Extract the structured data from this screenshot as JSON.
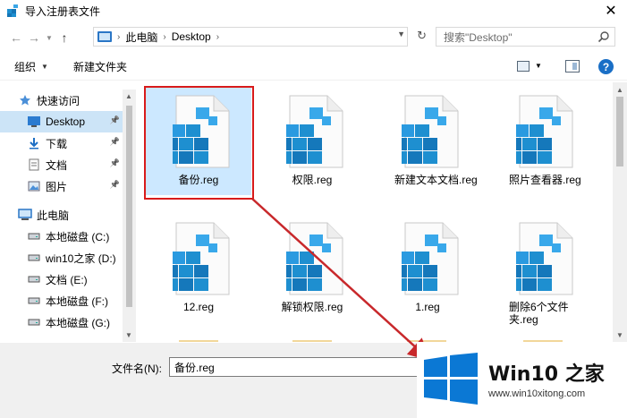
{
  "window": {
    "title": "导入注册表文件"
  },
  "address": {
    "crumbs": [
      "此电脑",
      "Desktop"
    ]
  },
  "search": {
    "placeholder": "搜索\"Desktop\""
  },
  "toolbar": {
    "organize": "组织",
    "new_folder": "新建文件夹"
  },
  "sidebar": {
    "items": [
      {
        "label": "快速访问",
        "icon": "star-icon",
        "pinned": false,
        "selected": false,
        "indent": 1
      },
      {
        "label": "Desktop",
        "icon": "desktop-icon",
        "pinned": true,
        "selected": true,
        "indent": 2
      },
      {
        "label": "下载",
        "icon": "download-icon",
        "pinned": true,
        "selected": false,
        "indent": 2
      },
      {
        "label": "文档",
        "icon": "document-icon",
        "pinned": true,
        "selected": false,
        "indent": 2
      },
      {
        "label": "图片",
        "icon": "picture-icon",
        "pinned": true,
        "selected": false,
        "indent": 2
      },
      {
        "label": "此电脑",
        "icon": "computer-icon",
        "pinned": false,
        "selected": false,
        "indent": 1
      },
      {
        "label": "本地磁盘 (C:)",
        "icon": "drive-icon",
        "pinned": false,
        "selected": false,
        "indent": 2
      },
      {
        "label": "win10之家 (D:)",
        "icon": "drive-icon",
        "pinned": false,
        "selected": false,
        "indent": 2
      },
      {
        "label": "文档 (E:)",
        "icon": "drive-icon",
        "pinned": false,
        "selected": false,
        "indent": 2
      },
      {
        "label": "本地磁盘 (F:)",
        "icon": "drive-icon",
        "pinned": false,
        "selected": false,
        "indent": 2
      },
      {
        "label": "本地磁盘 (G:)",
        "icon": "drive-icon",
        "pinned": false,
        "selected": false,
        "indent": 2
      }
    ]
  },
  "files": [
    {
      "name": "备份.reg",
      "selected": true
    },
    {
      "name": "权限.reg",
      "selected": false
    },
    {
      "name": "新建文本文档.reg",
      "selected": false
    },
    {
      "name": "照片查看器.reg",
      "selected": false
    },
    {
      "name": "12.reg",
      "selected": false
    },
    {
      "name": "解锁权限.reg",
      "selected": false
    },
    {
      "name": "1.reg",
      "selected": false
    },
    {
      "name": "删除6个文件夹.reg",
      "selected": false
    }
  ],
  "footer": {
    "filename_label": "文件名(N):",
    "filename_value": "备份.reg"
  },
  "watermark": {
    "brand": "Win10 之家",
    "url": "www.win10xitong.com"
  },
  "colors": {
    "accent": "#1a6fc6",
    "selection": "#cce8ff",
    "highlight_box": "#d81b1b",
    "reg_cube": "#1e8fd0"
  }
}
